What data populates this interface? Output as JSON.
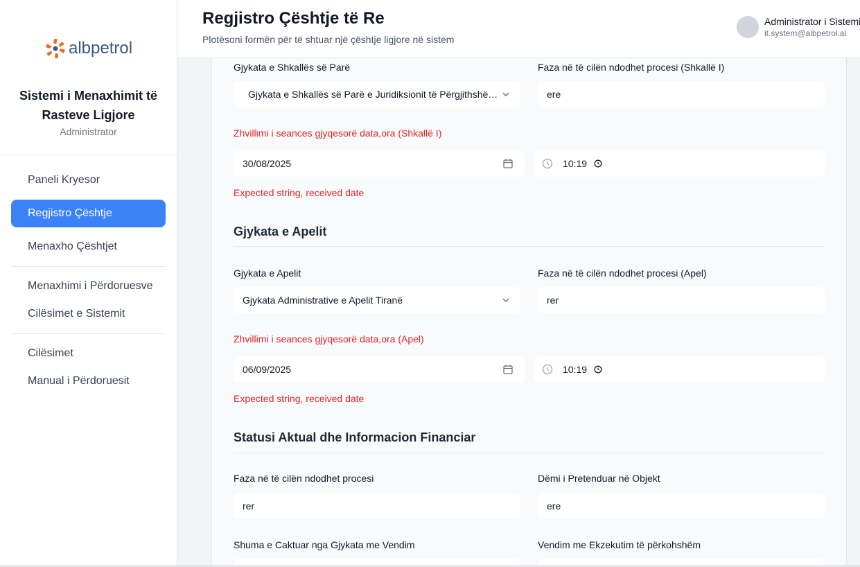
{
  "brand": {
    "logo_text": "albpetrol",
    "system_title": "Sistemi i Menaxhimit të Rasteve Ligjore",
    "role": "Administrator",
    "logo_color_orange": "#e8702a",
    "logo_color_blue": "#3a5a80"
  },
  "sidebar": {
    "items": [
      {
        "label": "Paneli Kryesor",
        "active": false
      },
      {
        "label": "Regjistro Çështje",
        "active": true
      },
      {
        "label": "Menaxho Çështjet",
        "active": false
      },
      {
        "label": "Menaxhimi i Përdoruesve",
        "active": false
      },
      {
        "label": "Cilësimet e Sistemit",
        "active": false
      },
      {
        "label": "Cilësimet",
        "active": false
      },
      {
        "label": "Manual i Përdoruesit",
        "active": false
      }
    ]
  },
  "header": {
    "title": "Regjistro Çështje të Re",
    "subtitle": "Plotësoni formën për të shtuar një çështje ligjore në sistem",
    "user_name": "Administrator i Sistemit",
    "user_email": "it.system@albpetrol.al"
  },
  "first_instance": {
    "court_label": "Gjykata e Shkallës së Parë",
    "court_value": "Gjykata e Shkallës së Parë e Juridiksionit të Përgjithshëm Tiranë",
    "phase_label": "Faza në të cilën ndodhet procesi (Shkallë I)",
    "phase_value": "ere",
    "hearing_label": "Zhvillimi i seances gjyqesorë data,ora (Shkallë I)",
    "date_value": "30/08/2025",
    "time_value": "10:19",
    "error": "Expected string, received date"
  },
  "appeal": {
    "section_title": "Gjykata e Apelit",
    "court_label": "Gjykata e Apelit",
    "court_value": "Gjykata Administrative e Apelit Tiranë",
    "phase_label": "Faza në të cilën ndodhet procesi (Apel)",
    "phase_value": "rer",
    "hearing_label": "Zhvillimi i seances gjyqesorë data,ora (Apel)",
    "date_value": "06/09/2025",
    "time_value": "10:19",
    "error": "Expected string, received date"
  },
  "status": {
    "section_title": "Statusi Aktual dhe Informacion Financiar",
    "phase_label": "Faza në të cilën ndodhet procesi",
    "phase_value": "rer",
    "damage_label": "Dëmi i Pretenduar në Objekt",
    "damage_value": "ere",
    "amount_label": "Shuma e Caktuar nga Gjykata me Vendim",
    "execution_label": "Vendim me Ekzekutim të përkohshëm"
  },
  "colors": {
    "accent": "#3b82f6",
    "error": "#dc2626"
  }
}
